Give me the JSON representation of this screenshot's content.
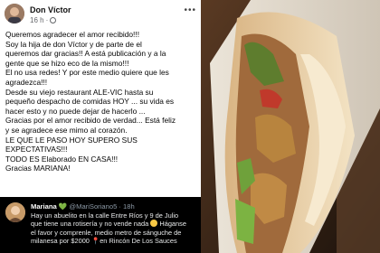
{
  "post": {
    "author": "Don Víctor",
    "time": "16 h",
    "lines": [
      "Queremos agradecer el amor recibido!!!",
      "Soy la hija de don Víctor y de parte de el",
      "queremos dar gracias!! A está publicación y a la",
      "gente que se hizo eco de la mismo!!!",
      "El no usa redes! Y  por este medio quiere que les",
      "agradezca!!!",
      "Desde su viejo restaurant ALE-VIC hasta su",
      "pequeño despacho de comidas HOY ... su vida es",
      "hacer esto y no puede dejar de hacerlo ...",
      "Gracias por el amor recibido de verdad... Está feliz",
      "y se agradece ese mimo al corazón.",
      "LE QUE LE PASO HOY SUPERO SUS",
      "EXPECTATIVAS!!!",
      "TODO ES Elaborado EN CASA!!!",
      "Gracias MARIANA!"
    ]
  },
  "tweet": {
    "name": "Mariana",
    "heart": "💚",
    "handle": "@MariSoriano5",
    "time": "· 18h",
    "line1": "Hay un abuelito en la calle Entre Ríos y 9 de Julio",
    "line2a": "que tiene una rotisería y no vende nada ",
    "line2b": " Háganse",
    "line3": "el favor y comprenle, medio metro de sánguche de",
    "line4a": "milanesa por $2000 ",
    "line4pin": "📍",
    "line4b": "en Rincón De Los Sauces"
  },
  "colors": {
    "meta": "#65676b",
    "tweet_bg": "#000000",
    "tweet_text": "#e7e9ea"
  },
  "icons": [
    "globe-icon",
    "more-options-icon",
    "sad-face-icon",
    "pin-icon"
  ]
}
